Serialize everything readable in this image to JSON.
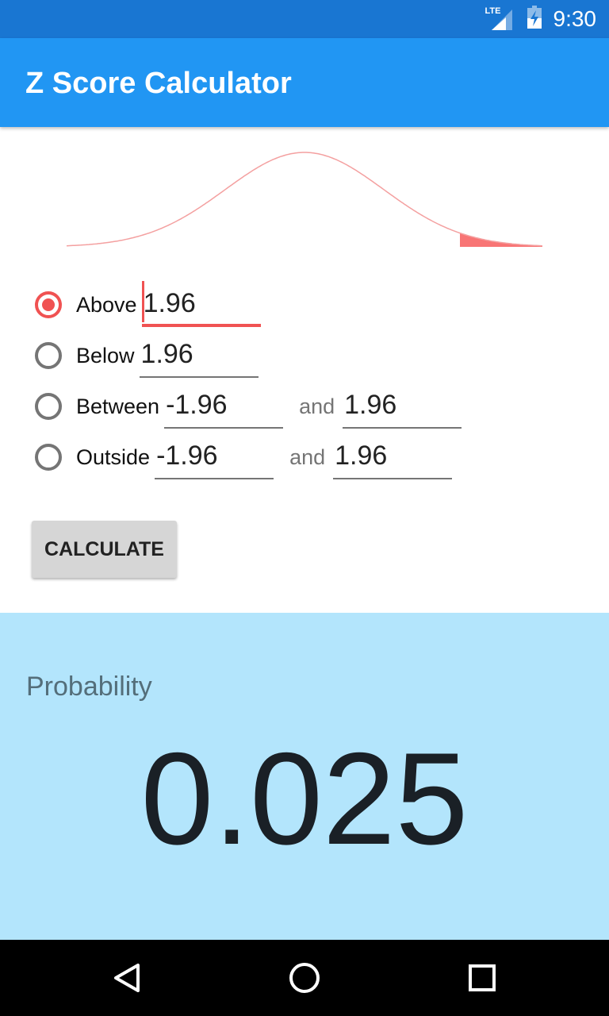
{
  "status_bar": {
    "network": "LTE",
    "time": "9:30",
    "icons": [
      "lte-signal-icon",
      "battery-charging-icon"
    ]
  },
  "app_bar": {
    "title": "Z Score Calculator"
  },
  "curve": {
    "shaded_region": "above",
    "z_threshold": 1.96,
    "z_range": [
      -3,
      3
    ],
    "line_color": "#f4a0a0",
    "fill_color": "#f87575"
  },
  "options": [
    {
      "label": "Above",
      "selected": true,
      "value1": "1.96"
    },
    {
      "label": "Below",
      "selected": false,
      "value1": "1.96"
    },
    {
      "label": "Between",
      "selected": false,
      "value1": "-1.96",
      "and_label": "and",
      "value2": "1.96"
    },
    {
      "label": "Outside",
      "selected": false,
      "value1": "-1.96",
      "and_label": "and",
      "value2": "1.96"
    }
  ],
  "calculate_button": {
    "label": "CALCULATE"
  },
  "result": {
    "label": "Probability",
    "value": "0.025"
  },
  "colors": {
    "primary": "#2196f3",
    "primary_dark": "#1976d2",
    "accent": "#f05252",
    "result_bg": "#b3e5fc"
  },
  "nav_bar": {
    "buttons": [
      "back-icon",
      "home-icon",
      "recents-icon"
    ]
  }
}
